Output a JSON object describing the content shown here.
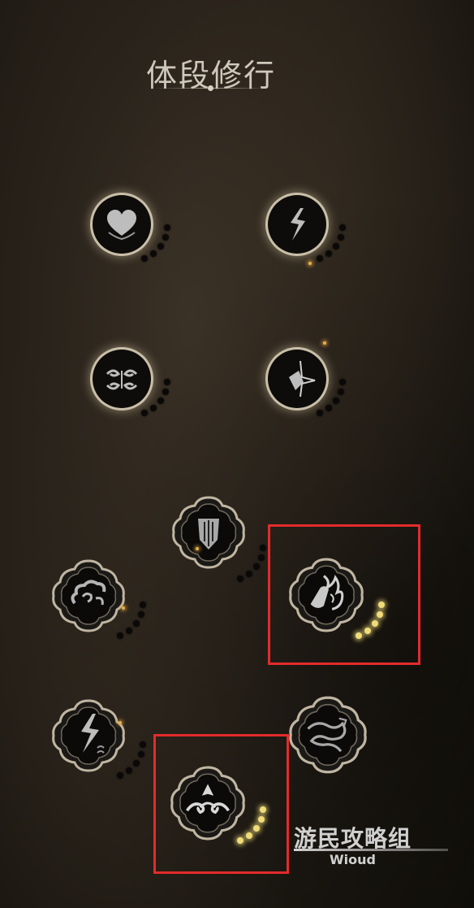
{
  "page": {
    "title": "体段修行"
  },
  "skills": [
    {
      "id": "heart",
      "icon": "heart-icon",
      "points_lit": 0,
      "points_total": 5,
      "selected": false
    },
    {
      "id": "lightning",
      "icon": "lightning-rune-icon",
      "points_lit": 0,
      "points_total": 5,
      "selected": false
    },
    {
      "id": "swirl-mirror",
      "icon": "mirrored-swirl-icon",
      "points_lit": 0,
      "points_total": 5,
      "selected": false
    },
    {
      "id": "spark-shard",
      "icon": "spark-shard-icon",
      "points_lit": 0,
      "points_total": 5,
      "selected": false
    },
    {
      "id": "shield",
      "icon": "shield-icon",
      "points_lit": 0,
      "points_total": 5,
      "selected": false
    },
    {
      "id": "cloud",
      "icon": "cloud-swirl-icon",
      "points_lit": 0,
      "points_total": 5,
      "selected": false
    },
    {
      "id": "gourd-flame",
      "icon": "gourd-flame-icon",
      "points_lit": 5,
      "points_total": 5,
      "selected": true
    },
    {
      "id": "lightning-wave",
      "icon": "lightning-wave-icon",
      "points_lit": 0,
      "points_total": 5,
      "selected": false
    },
    {
      "id": "dragon",
      "icon": "dragon-icon",
      "points_lit": 0,
      "points_total": 5,
      "selected": false
    },
    {
      "id": "cloud-crest",
      "icon": "cloud-crest-icon",
      "points_lit": 5,
      "points_total": 5,
      "selected": true
    }
  ],
  "watermark": {
    "main": "游民攻略组",
    "sub": "Wioud"
  },
  "colors": {
    "highlight": "#e32b2b",
    "point_lit": "#f0dc7a",
    "ring": "#c9bfa8"
  }
}
